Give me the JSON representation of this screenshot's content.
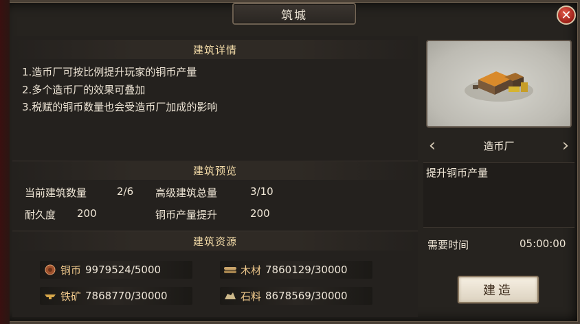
{
  "window": {
    "title": "筑城"
  },
  "details": {
    "header": "建筑详情",
    "lines": [
      "1.造币厂可按比例提升玩家的铜币产量",
      "2.多个造币厂的效果可叠加",
      "3.税赋的铜币数量也会受造币厂加成的影响"
    ]
  },
  "preview_section": {
    "header": "建筑预览",
    "current_count_label": "当前建筑数量",
    "current_count_value": "2/6",
    "advanced_total_label": "高级建筑总量",
    "advanced_total_value": "3/10",
    "durability_label": "耐久度",
    "durability_value": "200",
    "copper_boost_label": "铜币产量提升",
    "copper_boost_value": "200"
  },
  "resources": {
    "header": "建筑资源",
    "copper": {
      "name": "铜币",
      "value": "9979524/5000",
      "icon": "copper-coin-icon"
    },
    "wood": {
      "name": "木材",
      "value": "7860129/30000",
      "icon": "wood-icon"
    },
    "iron": {
      "name": "铁矿",
      "value": "7868770/30000",
      "icon": "iron-ore-icon"
    },
    "stone": {
      "name": "石料",
      "value": "8678569/30000",
      "icon": "stone-icon"
    }
  },
  "building": {
    "name": "造币厂",
    "effect": "提升铜币产量",
    "time_label": "需要时间",
    "time_value": "05:00:00",
    "build_button": "建造"
  },
  "colors": {
    "header_text": "#f1d9a6",
    "resource_name": "#f0c98c",
    "close_button": "#c0392b"
  }
}
